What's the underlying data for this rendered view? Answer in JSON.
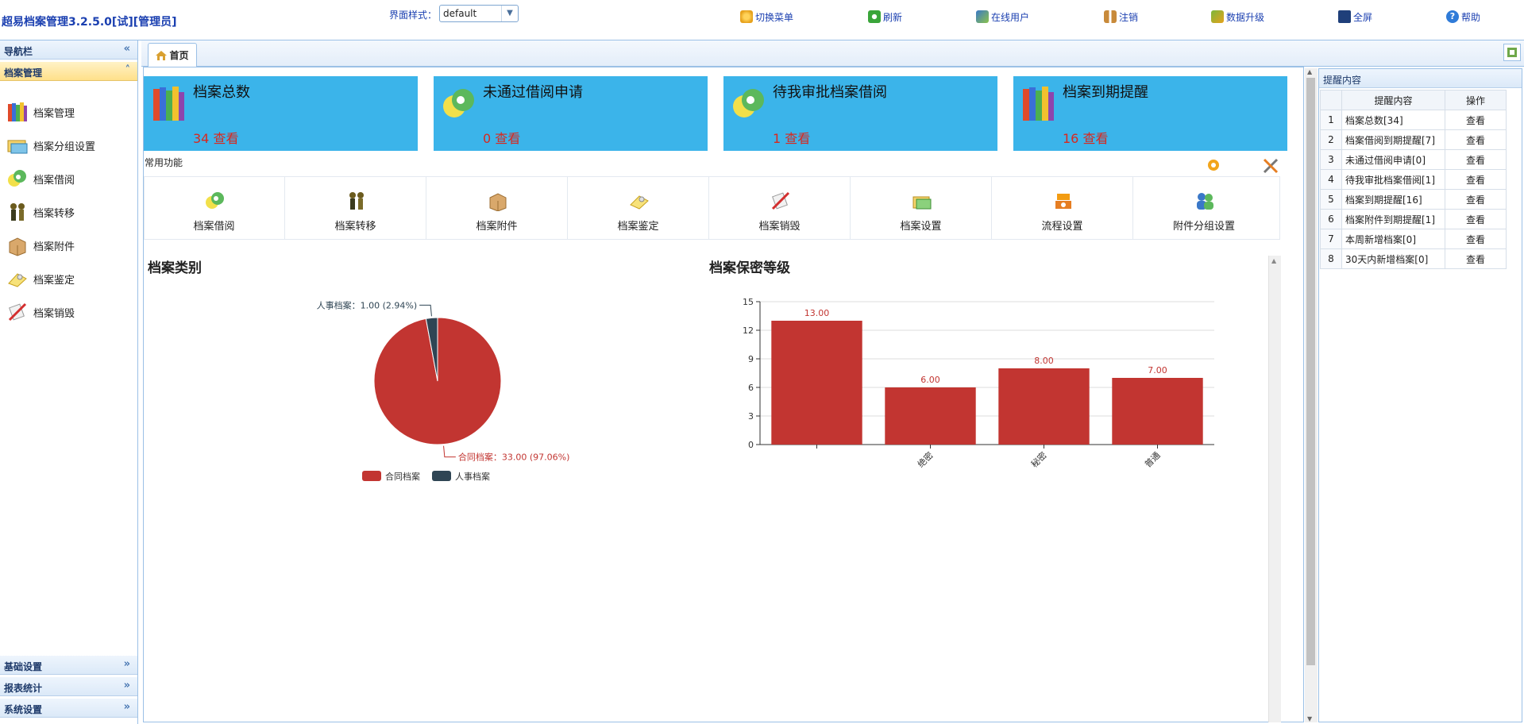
{
  "app": {
    "title": "超易档案管理3.2.5.0[试][管理员]",
    "theme_label": "界面样式：",
    "theme_value": "default"
  },
  "toolbar": {
    "buttons": [
      {
        "label": "切换菜单",
        "icon": "switch-menu-icon",
        "color": "#e7a21c"
      },
      {
        "label": "刷新",
        "icon": "refresh-icon",
        "color": "#3aa53a"
      },
      {
        "label": "在线用户",
        "icon": "online-users-icon",
        "color": "#3a78c8"
      },
      {
        "label": "注销",
        "icon": "logout-icon",
        "color": "#c88a3a"
      },
      {
        "label": "数据升级",
        "icon": "data-upgrade-icon",
        "color": "#7bb83a"
      },
      {
        "label": "全屏",
        "icon": "fullscreen-icon",
        "color": "#1f3f7a"
      },
      {
        "label": "帮助",
        "icon": "help-icon",
        "color": "#2f7bd8"
      }
    ]
  },
  "sidebar": {
    "header": "导航栏",
    "active_group": "档案管理",
    "items": [
      {
        "label": "档案管理",
        "icon": "books-icon"
      },
      {
        "label": "档案分组设置",
        "icon": "folder-group-icon"
      },
      {
        "label": "档案借阅",
        "icon": "borrow-icon"
      },
      {
        "label": "档案转移",
        "icon": "transfer-icon"
      },
      {
        "label": "档案附件",
        "icon": "attachment-box-icon"
      },
      {
        "label": "档案鉴定",
        "icon": "appraise-icon"
      },
      {
        "label": "档案销毁",
        "icon": "destroy-icon"
      }
    ],
    "bottom_groups": [
      "基础设置",
      "报表统计",
      "系统设置"
    ]
  },
  "tabs": {
    "home": "首页"
  },
  "cards": [
    {
      "title": "档案总数",
      "count": "34 查看",
      "icon": "books-icon"
    },
    {
      "title": "未通过借阅申请",
      "count": "0 查看",
      "icon": "borrow-icon"
    },
    {
      "title": "待我审批档案借阅",
      "count": "1 查看",
      "icon": "borrow-icon"
    },
    {
      "title": "档案到期提醒",
      "count": "16 查看",
      "icon": "books-icon"
    }
  ],
  "quick": {
    "label": "常用功能",
    "items": [
      {
        "label": "档案借阅",
        "icon": "borrow-icon"
      },
      {
        "label": "档案转移",
        "icon": "transfer-icon"
      },
      {
        "label": "档案附件",
        "icon": "attachment-box-icon"
      },
      {
        "label": "档案鉴定",
        "icon": "appraise-icon"
      },
      {
        "label": "档案销毁",
        "icon": "destroy-icon"
      },
      {
        "label": "档案设置",
        "icon": "settings-folder-icon"
      },
      {
        "label": "流程设置",
        "icon": "workflow-icon"
      },
      {
        "label": "附件分组设置",
        "icon": "users-group-icon"
      }
    ]
  },
  "reminder": {
    "header": "提醒内容",
    "col_content": "提醒内容",
    "col_op": "操作",
    "rows": [
      {
        "n": "1",
        "content": "档案总数[34]",
        "op": "查看"
      },
      {
        "n": "2",
        "content": "档案借阅到期提醒[7]",
        "op": "查看"
      },
      {
        "n": "3",
        "content": "未通过借阅申请[0]",
        "op": "查看"
      },
      {
        "n": "4",
        "content": "待我审批档案借阅[1]",
        "op": "查看"
      },
      {
        "n": "5",
        "content": "档案到期提醒[16]",
        "op": "查看"
      },
      {
        "n": "6",
        "content": "档案附件到期提醒[1]",
        "op": "查看"
      },
      {
        "n": "7",
        "content": "本周新增档案[0]",
        "op": "查看"
      },
      {
        "n": "8",
        "content": "30天内新增档案[0]",
        "op": "查看"
      }
    ]
  },
  "chart_data": [
    {
      "type": "pie",
      "title": "档案类别",
      "legend_position": "bottom",
      "colors": [
        "#c23531",
        "#2f4554"
      ],
      "slices": [
        {
          "name": "合同档案",
          "value": 33.0,
          "label": "合同档案：33.00 (97.06%)"
        },
        {
          "name": "人事档案",
          "value": 1.0,
          "label": "人事档案：1.00 (2.94%)"
        }
      ]
    },
    {
      "type": "bar",
      "title": "档案保密等级",
      "color": "#c23531",
      "categories": [
        "",
        "绝密",
        "秘密",
        "普通"
      ],
      "values": [
        13,
        6,
        8,
        7
      ],
      "value_labels": [
        "13.00",
        "6.00",
        "8.00",
        "7.00"
      ],
      "ylim": [
        0,
        15
      ],
      "yticks": [
        "0",
        "3",
        "6",
        "9",
        "12",
        "15"
      ],
      "grid": true
    }
  ]
}
